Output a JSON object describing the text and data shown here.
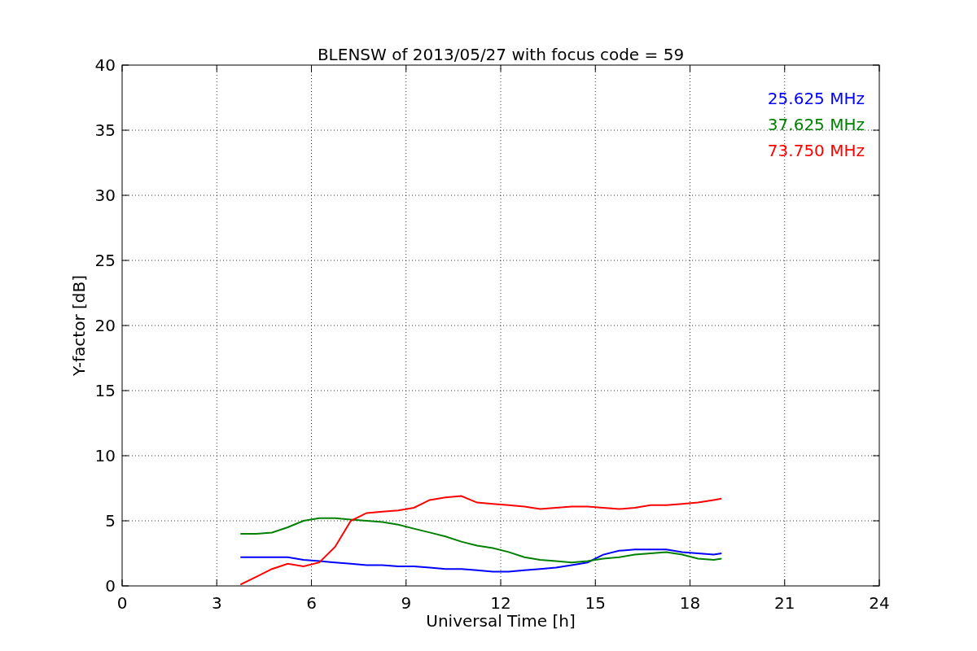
{
  "figure": {
    "chart_data": {
      "type": "line",
      "title": "BLENSW of 2013/05/27 with focus code = 59",
      "xlabel": "Universal Time [h]",
      "ylabel": "Y-factor [dB]",
      "x": [
        3.75,
        4.25,
        4.75,
        5.25,
        5.75,
        6.25,
        6.75,
        7.25,
        7.75,
        8.25,
        8.75,
        9.25,
        9.75,
        10.25,
        10.75,
        11.25,
        11.75,
        12.25,
        12.75,
        13.25,
        13.75,
        14.25,
        14.75,
        15.25,
        15.75,
        16.25,
        16.75,
        17.25,
        17.75,
        18.25,
        18.75,
        19.0
      ],
      "series": [
        {
          "name": "25.625 MHz",
          "color": "#0000ff",
          "values": [
            2.2,
            2.2,
            2.2,
            2.2,
            2.0,
            1.9,
            1.8,
            1.7,
            1.6,
            1.6,
            1.5,
            1.5,
            1.4,
            1.3,
            1.3,
            1.2,
            1.1,
            1.1,
            1.2,
            1.3,
            1.4,
            1.6,
            1.8,
            2.4,
            2.7,
            2.8,
            2.8,
            2.8,
            2.6,
            2.5,
            2.4,
            2.5
          ]
        },
        {
          "name": "37.625 MHz",
          "color": "#008000",
          "values": [
            4.0,
            4.0,
            4.1,
            4.5,
            5.0,
            5.2,
            5.2,
            5.1,
            5.0,
            4.9,
            4.7,
            4.4,
            4.1,
            3.8,
            3.4,
            3.1,
            2.9,
            2.6,
            2.2,
            2.0,
            1.9,
            1.8,
            1.9,
            2.1,
            2.2,
            2.4,
            2.5,
            2.6,
            2.4,
            2.1,
            2.0,
            2.1
          ]
        },
        {
          "name": "73.750 MHz",
          "color": "#ff0000",
          "values": [
            0.1,
            0.7,
            1.3,
            1.7,
            1.5,
            1.8,
            3.0,
            5.0,
            5.6,
            5.7,
            5.8,
            6.0,
            6.6,
            6.8,
            6.9,
            6.4,
            6.3,
            6.2,
            6.1,
            5.9,
            6.0,
            6.1,
            6.1,
            6.0,
            5.9,
            6.0,
            6.2,
            6.2,
            6.3,
            6.4,
            6.6,
            6.7
          ]
        }
      ],
      "grid": true,
      "xlim": [
        0,
        24
      ],
      "ylim": [
        0,
        40
      ],
      "xticks": [
        0,
        3,
        6,
        9,
        12,
        15,
        18,
        21,
        24
      ],
      "yticks": [
        0,
        5,
        10,
        15,
        20,
        25,
        30,
        35,
        40
      ]
    }
  }
}
